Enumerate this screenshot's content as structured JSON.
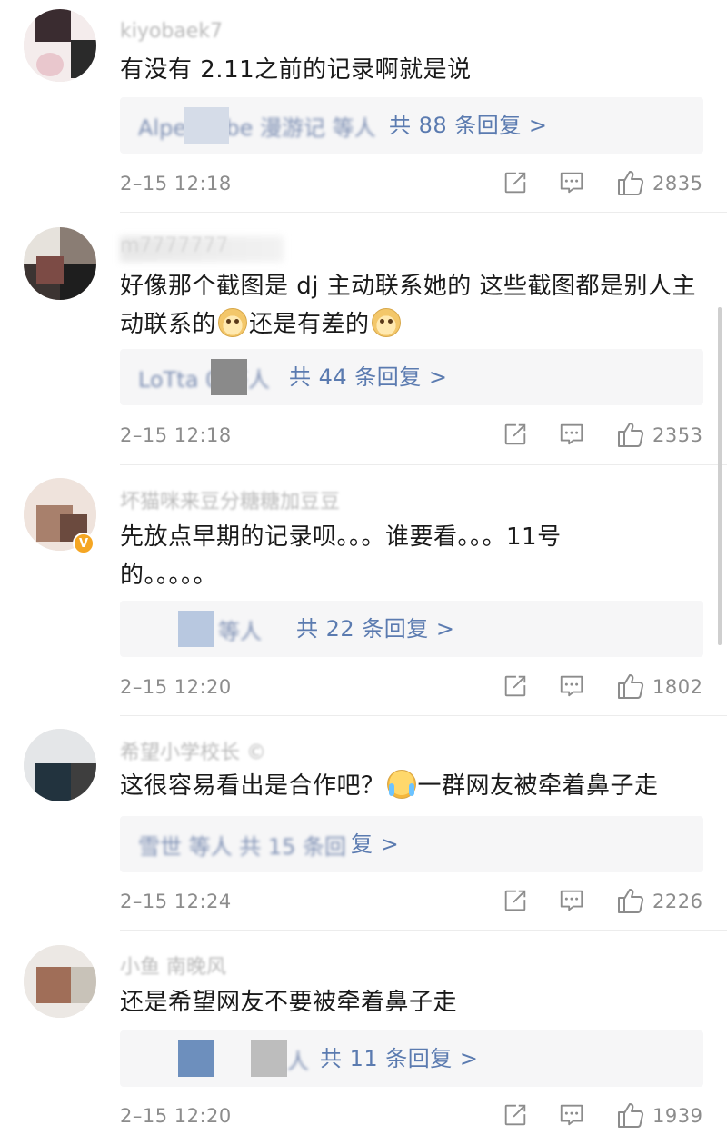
{
  "comments": [
    {
      "username": "kiyobaek7",
      "text": "有没有 2.11之前的记录啊就是说",
      "reply_names": "Alpenliebe 漫游记 等人",
      "reply_count": "共 88 条回复 >",
      "timestamp": "2–15 12:18",
      "likes": "2835"
    },
    {
      "username": "m7777777",
      "text_part1": "好像那个截图是 dj 主动联系她的 这些截图都是别人主动联系的",
      "text_part2": "还是有差的",
      "emoji": "doge-emoji",
      "reply_names": "LoTta 0 等人",
      "reply_count": "共 44 条回复 >",
      "timestamp": "2–15 12:18",
      "likes": "2353"
    },
    {
      "username": "坏猫咪来豆分糖糖加豆豆",
      "verified": "V",
      "text": "先放点早期的记录呗。。。谁要看。。。11号的。。。。。",
      "reply_names": "等人",
      "reply_count": "共 22 条回复 >",
      "timestamp": "2–15 12:20",
      "likes": "1802"
    },
    {
      "username": "希望小学校长 ©",
      "text_part1": "这很容易看出是合作吧？",
      "text_part2": "一群网友被牵着鼻子走",
      "emoji": "laugh-cry-emoji",
      "reply_names": "雪世 等人 共 15 条回",
      "reply_count": "复 >",
      "timestamp": "2–15 12:24",
      "likes": "2226"
    },
    {
      "username": "小鱼 南晚风",
      "text": "还是希望网友不要被牵着鼻子走",
      "reply_names": "人",
      "reply_count": "共 11 条回复 >",
      "timestamp": "2–15 12:20",
      "likes": "1939"
    }
  ],
  "icons": {
    "share": "share-icon",
    "comment": "comment-icon",
    "like": "thumbs-up-icon"
  },
  "colors": {
    "reply_link": "#5b7bb0",
    "meta_gray": "#8c8c8c",
    "reply_bg": "#f6f6f7",
    "verified_badge": "#f5a623"
  }
}
